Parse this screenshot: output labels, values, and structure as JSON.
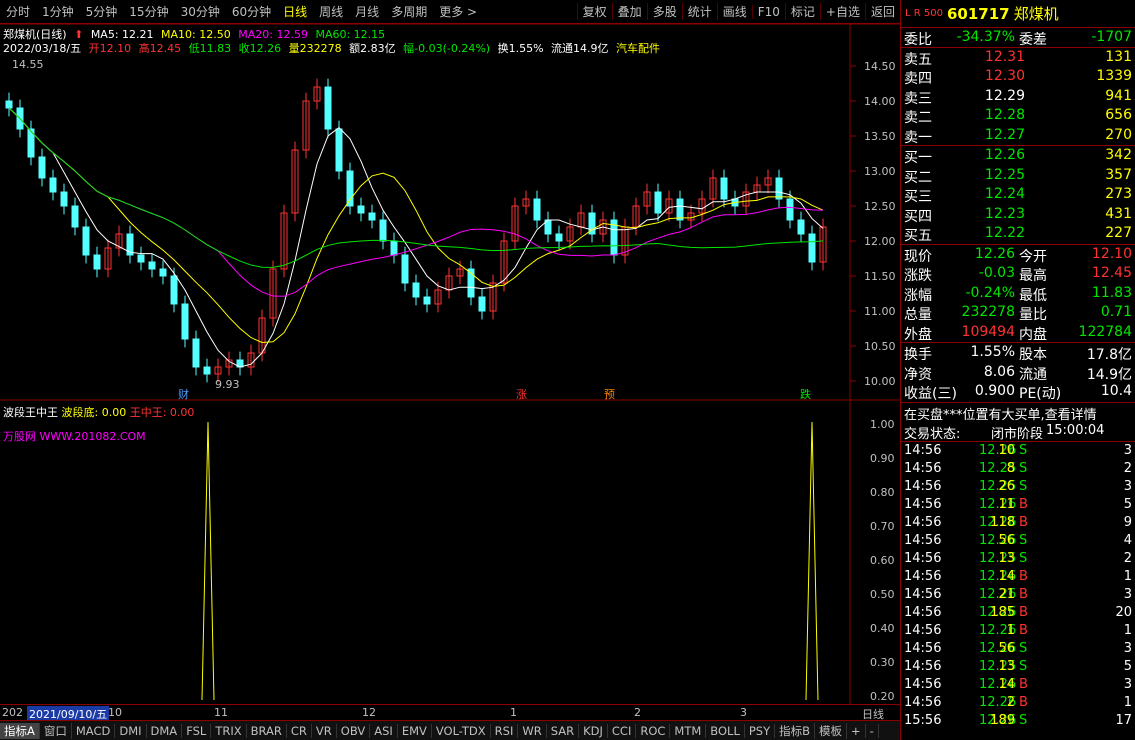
{
  "toolbar": {
    "tabs": [
      "分时",
      "1分钟",
      "5分钟",
      "15分钟",
      "30分钟",
      "60分钟",
      "日线",
      "周线",
      "月线",
      "多周期",
      "更多 >"
    ],
    "active": "日线",
    "buttons": [
      "复权",
      "叠加",
      "多股",
      "统计",
      "画线",
      "F10",
      "标记",
      "+自选",
      "返回"
    ]
  },
  "chart_info": {
    "stock": "郑煤机(日线)",
    "ma5": "MA5: 12.21",
    "ma10": "MA10: 12.50",
    "ma20": "MA20: 12.59",
    "ma60": "MA60: 12.15",
    "date": "2022/03/18/五",
    "open": "开12.10",
    "high": "高12.45",
    "low": "低11.83",
    "close": "收12.26",
    "vol": "量232278",
    "amt": "额2.83亿",
    "chg": "幅-0.03(-0.24%)",
    "turn": "换1.55%",
    "float": "流通14.9亿",
    "sector": "汽车配件",
    "max_label": "14.55",
    "min_label": "9.93",
    "markers": [
      "财",
      "涨",
      "预",
      "跌"
    ]
  },
  "y_axis_main": [
    "14.50",
    "14.00",
    "13.50",
    "13.00",
    "12.50",
    "12.00",
    "11.50",
    "11.00",
    "10.50",
    "10.00"
  ],
  "y_axis_sub": [
    "1.00",
    "0.90",
    "0.80",
    "0.70",
    "0.60",
    "0.50",
    "0.40",
    "0.30",
    "0.20"
  ],
  "sub_info": {
    "name": "波段王中王",
    "label1": "波段底: 0.00",
    "label2": "王中王: 0.00",
    "url": "万股网 WWW.201082.COM"
  },
  "date_axis": {
    "left": "202",
    "selected": "2021/09/10/五",
    "ticks": [
      "10",
      "11",
      "12",
      "1",
      "2",
      "3"
    ],
    "right": "日线"
  },
  "bottom_tabs": [
    "指标A",
    "窗口",
    "MACD",
    "DMI",
    "DMA",
    "FSL",
    "TRIX",
    "BRAR",
    "CR",
    "VR",
    "OBV",
    "ASI",
    "EMV",
    "VOL-TDX",
    "RSI",
    "WR",
    "SAR",
    "KDJ",
    "CCI",
    "ROC",
    "MTM",
    "BOLL",
    "PSY",
    "指标B",
    "模板",
    "+",
    "-"
  ],
  "stock": {
    "code": "601717",
    "name": "郑煤机",
    "lr": "L R 500"
  },
  "weibi": {
    "label": "委比",
    "value": "-34.37%",
    "label2": "委差",
    "value2": "-1707"
  },
  "asks": [
    {
      "label": "卖五",
      "price": "12.31",
      "vol": "131"
    },
    {
      "label": "卖四",
      "price": "12.30",
      "vol": "1339"
    },
    {
      "label": "卖三",
      "price": "12.29",
      "vol": "941"
    },
    {
      "label": "卖二",
      "price": "12.28",
      "vol": "656"
    },
    {
      "label": "卖一",
      "price": "12.27",
      "vol": "270"
    }
  ],
  "bids": [
    {
      "label": "买一",
      "price": "12.26",
      "vol": "342"
    },
    {
      "label": "买二",
      "price": "12.25",
      "vol": "357"
    },
    {
      "label": "买三",
      "price": "12.24",
      "vol": "273"
    },
    {
      "label": "买四",
      "price": "12.23",
      "vol": "431"
    },
    {
      "label": "买五",
      "price": "12.22",
      "vol": "227"
    }
  ],
  "quote": [
    {
      "l1": "现价",
      "v1": "12.26",
      "l2": "今开",
      "v2": "12.10"
    },
    {
      "l1": "涨跌",
      "v1": "-0.03",
      "l2": "最高",
      "v2": "12.45"
    },
    {
      "l1": "涨幅",
      "v1": "-0.24%",
      "l2": "最低",
      "v2": "11.83"
    },
    {
      "l1": "总量",
      "v1": "232278",
      "l2": "量比",
      "v2": "0.71"
    },
    {
      "l1": "外盘",
      "v1": "109494",
      "l2": "内盘",
      "v2": "122784"
    }
  ],
  "fin": [
    {
      "l1": "换手",
      "v1": "1.55%",
      "l2": "股本",
      "v2": "17.8亿"
    },
    {
      "l1": "净资",
      "v1": "8.06",
      "l2": "流通",
      "v2": "14.9亿"
    },
    {
      "l1": "收益(三)",
      "v1": "0.900",
      "l2": "PE(动)",
      "v2": "10.4"
    }
  ],
  "notice": "在买盘***位置有大买单,查看详情",
  "trade_state": {
    "label": "交易状态:",
    "value": "闭市阶段",
    "time": "15:00:04"
  },
  "ticks": [
    [
      "14:56",
      "12.26",
      "10",
      "S",
      "3"
    ],
    [
      "14:56",
      "12.25",
      "8",
      "S",
      "2"
    ],
    [
      "14:56",
      "12.25",
      "26",
      "S",
      "3"
    ],
    [
      "14:56",
      "12.26",
      "11",
      "B",
      "5"
    ],
    [
      "14:56",
      "12.26",
      "118",
      "B",
      "9"
    ],
    [
      "14:56",
      "12.26",
      "56",
      "S",
      "4"
    ],
    [
      "14:56",
      "12.25",
      "13",
      "S",
      "2"
    ],
    [
      "14:56",
      "12.26",
      "14",
      "B",
      "1"
    ],
    [
      "14:56",
      "12.26",
      "21",
      "B",
      "3"
    ],
    [
      "14:56",
      "12.26",
      "185",
      "B",
      "20"
    ],
    [
      "14:56",
      "12.26",
      "1",
      "B",
      "1"
    ],
    [
      "14:56",
      "12.26",
      "56",
      "S",
      "3"
    ],
    [
      "14:56",
      "12.25",
      "13",
      "S",
      "5"
    ],
    [
      "14:56",
      "12.26",
      "14",
      "B",
      "3"
    ],
    [
      "14:56",
      "12.26",
      "2",
      "B",
      "1"
    ],
    [
      "15:56",
      "12.26",
      "189",
      "S",
      "17"
    ]
  ]
}
